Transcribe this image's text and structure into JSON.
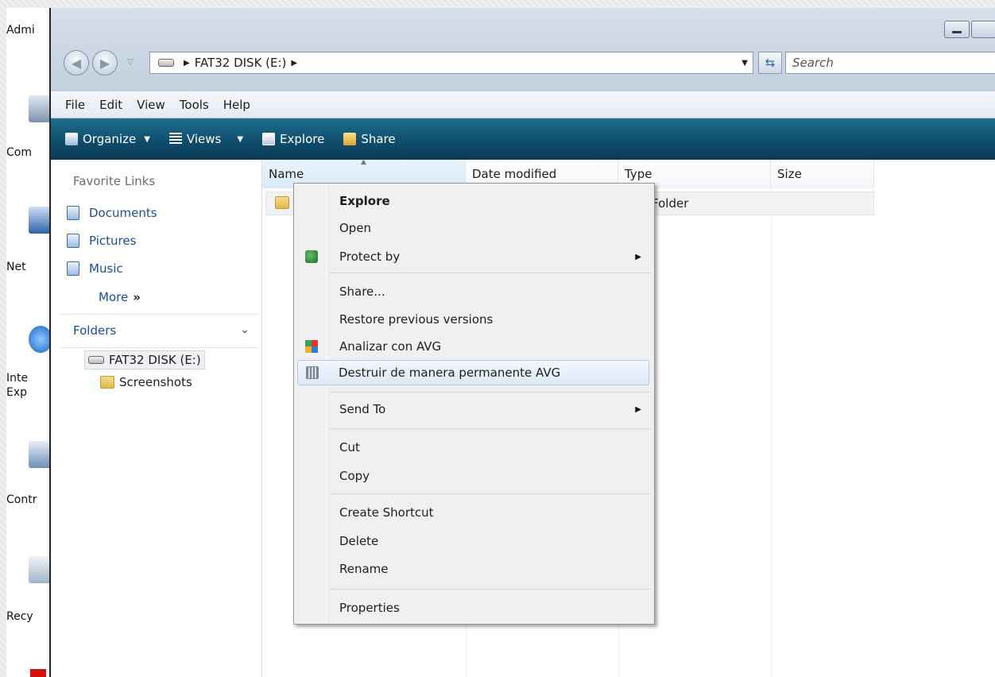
{
  "desktop": {
    "icons": [
      {
        "label": "Admi"
      },
      {
        "label": "Com"
      },
      {
        "label": "Net"
      },
      {
        "label": "Inte"
      },
      {
        "label": "Exp"
      },
      {
        "label": "Contr"
      },
      {
        "label": "Recy"
      }
    ]
  },
  "toolbar": {
    "address": "FAT32 DISK (E:)",
    "search_placeholder": "Search"
  },
  "menu": [
    "File",
    "Edit",
    "View",
    "Tools",
    "Help"
  ],
  "commands": {
    "organize": "Organize",
    "views": "Views",
    "explore": "Explore",
    "share": "Share"
  },
  "nav_pane": {
    "favorites_heading": "Favorite Links",
    "favorites": [
      "Documents",
      "Pictures",
      "Music"
    ],
    "more": "More",
    "more_glyph": "»",
    "folders_heading": "Folders",
    "tree": {
      "drive": "FAT32 DISK (E:)",
      "folder": "Screenshots"
    }
  },
  "columns": [
    "Name",
    "Date modified",
    "Type",
    "Size"
  ],
  "rows": [
    {
      "type": "Folder"
    }
  ],
  "context_menu": {
    "items": [
      {
        "label": "Explore",
        "bold": true
      },
      {
        "label": "Open"
      },
      {
        "label": "Protect by",
        "submenu": true,
        "icon": "shield-icon"
      },
      {
        "label": "Share..."
      },
      {
        "label": "Restore previous versions"
      },
      {
        "label": "Analizar con AVG",
        "icon": "avg-icon"
      },
      {
        "label": "Destruir de manera permanente AVG",
        "icon": "shredder-icon",
        "highlighted": true
      },
      {
        "label": "Send To",
        "submenu": true
      },
      {
        "label": "Cut"
      },
      {
        "label": "Copy"
      },
      {
        "label": "Create Shortcut"
      },
      {
        "label": "Delete"
      },
      {
        "label": "Rename"
      },
      {
        "label": "Properties"
      }
    ]
  },
  "colors": {
    "cmdbar": "#0f4d6c",
    "link": "#1a4f9c",
    "highlight": "#dde9f7"
  }
}
